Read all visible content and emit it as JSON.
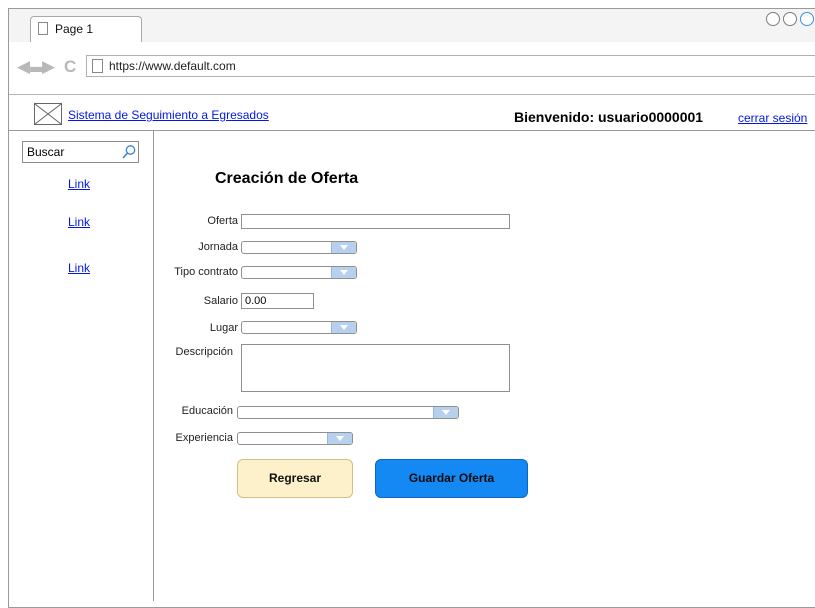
{
  "browser": {
    "tab_title": "Page 1",
    "url": "https://www.default.com"
  },
  "header": {
    "site_link": "Sistema de Seguimiento a Egresados",
    "welcome": "Bienvenido: usuario0000001",
    "logout": "cerrar sesión"
  },
  "sidebar": {
    "search_placeholder": "Buscar",
    "links": [
      "Link",
      "Link",
      "Link"
    ]
  },
  "form": {
    "title": "Creación de Oferta",
    "fields": {
      "oferta": {
        "label": "Oferta",
        "value": ""
      },
      "jornada": {
        "label": "Jornada",
        "value": ""
      },
      "tipo_contrato": {
        "label": "Tipo contrato",
        "value": ""
      },
      "salario": {
        "label": "Salario",
        "value": "0.00"
      },
      "lugar": {
        "label": "Lugar",
        "value": ""
      },
      "descripcion": {
        "label": "Descripción",
        "value": ""
      },
      "educacion": {
        "label": "Educación",
        "value": ""
      },
      "experiencia": {
        "label": "Experiencia",
        "value": ""
      }
    },
    "buttons": {
      "back": "Regresar",
      "save": "Guardar Oferta"
    }
  },
  "colors": {
    "link": "#0018e8",
    "save_button": "#1488f3",
    "back_button": "#fdf1cb",
    "select_button": "#b7d0ee"
  }
}
